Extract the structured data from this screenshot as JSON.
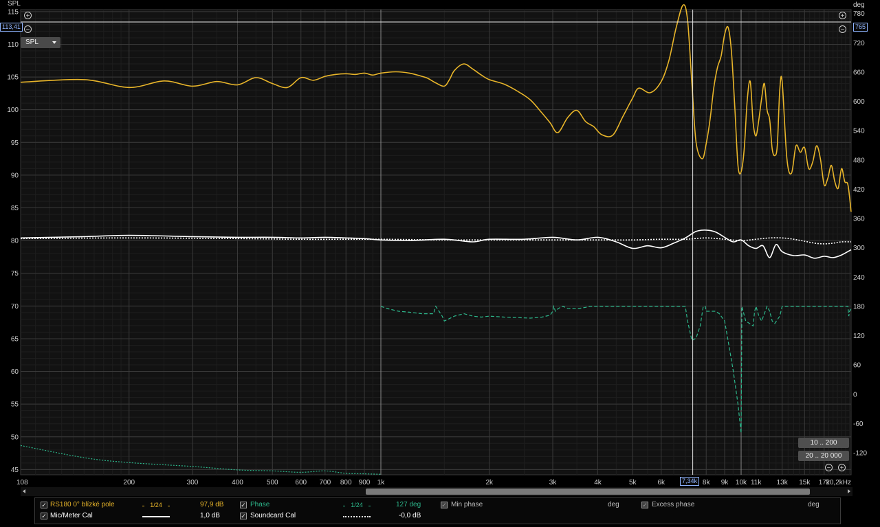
{
  "axes": {
    "left_unit": "SPL",
    "right_unit": "deg",
    "x_unit_suffix": "kHz",
    "left_ticks": [
      "115",
      "110",
      "105",
      "100",
      "95",
      "90",
      "85",
      "80",
      "75",
      "70",
      "65",
      "60",
      "55",
      "50",
      "45"
    ],
    "right_ticks": [
      "780",
      "720",
      "660",
      "600",
      "540",
      "480",
      "420",
      "360",
      "300",
      "240",
      "180",
      "120",
      "60",
      "0",
      "-60",
      "-120"
    ],
    "x_ticks": [
      {
        "f": 100,
        "label": "108"
      },
      {
        "f": 200,
        "label": "200"
      },
      {
        "f": 300,
        "label": "300"
      },
      {
        "f": 400,
        "label": "400"
      },
      {
        "f": 500,
        "label": "500"
      },
      {
        "f": 600,
        "label": "600"
      },
      {
        "f": 700,
        "label": "700"
      },
      {
        "f": 800,
        "label": "800"
      },
      {
        "f": 900,
        "label": "900"
      },
      {
        "f": 1000,
        "label": "1k"
      },
      {
        "f": 2000,
        "label": "2k"
      },
      {
        "f": 3000,
        "label": "3k"
      },
      {
        "f": 4000,
        "label": "4k"
      },
      {
        "f": 5000,
        "label": "5k"
      },
      {
        "f": 6000,
        "label": "6k"
      },
      {
        "f": 8000,
        "label": "8k"
      },
      {
        "f": 9000,
        "label": "9k"
      },
      {
        "f": 10000,
        "label": "10k"
      },
      {
        "f": 11000,
        "label": "11k"
      },
      {
        "f": 13000,
        "label": "13k"
      },
      {
        "f": 15000,
        "label": "15k"
      },
      {
        "f": 17000,
        "label": "17k"
      },
      {
        "f": 20200,
        "label": "20,2kHz"
      }
    ]
  },
  "controls": {
    "spl_select": "SPL",
    "range_low": "10 .. 200",
    "range_high": "20 .. 20 000",
    "zoom_in": "+",
    "zoom_out": "−"
  },
  "cursor": {
    "freq": 7340,
    "freq_label": "7,34k",
    "level": 113.41,
    "level_label": "113,41",
    "deg_label": "765"
  },
  "legend": {
    "row1": [
      {
        "label": "RS180 0° blízké pole",
        "smoothing": "1/24",
        "value": "97,9 dB",
        "color": "#e8b52a"
      },
      {
        "label": "Phase",
        "smoothing": "1/24",
        "value": "127 deg",
        "color": "#2db88c"
      },
      {
        "label": "Min phase",
        "value": "deg",
        "color": "#bdbdbd"
      },
      {
        "label": "Excess phase",
        "value": "deg",
        "color": "#bdbdbd"
      }
    ],
    "row2": [
      {
        "label": "Mic/Meter Cal",
        "value": "1,0 dB",
        "color": "#ffffff"
      },
      {
        "label": "Soundcard Cal",
        "value": "-0,0 dB",
        "color": "#ffffff"
      }
    ]
  },
  "chart_data": {
    "type": "line",
    "x_scale": "log",
    "xlim": [
      100,
      20200
    ],
    "ylim": [
      44.2,
      115.3
    ],
    "y2lim": [
      -165,
      788
    ],
    "grid": true,
    "series": [
      {
        "name": "RS180 0° blízké pole",
        "axis": "left",
        "color": "#e8b52a",
        "x": [
          100,
          150,
          200,
          250,
          300,
          350,
          400,
          450,
          500,
          550,
          600,
          650,
          700,
          750,
          800,
          850,
          900,
          950,
          1000,
          1100,
          1200,
          1300,
          1350,
          1420,
          1500,
          1550,
          1600,
          1700,
          1800,
          1900,
          2000,
          2200,
          2400,
          2600,
          2800,
          2950,
          3100,
          3300,
          3500,
          3700,
          3900,
          4100,
          4400,
          4700,
          5000,
          5200,
          5600,
          6000,
          6300,
          6600,
          6900,
          7100,
          7300,
          7500,
          7800,
          8000,
          8200,
          8400,
          8600,
          8800,
          9000,
          9200,
          9400,
          9600,
          9800,
          10000,
          10200,
          10400,
          10600,
          10800,
          11000,
          11200,
          11400,
          11600,
          11800,
          12000,
          12200,
          12400,
          12600,
          12800,
          13000,
          13400,
          13800,
          14200,
          14600,
          15000,
          15400,
          15800,
          16200,
          16600,
          17000,
          17400,
          17800,
          18200,
          18600,
          19000,
          19400,
          19800,
          20200
        ],
        "y": [
          104.2,
          104.6,
          103.4,
          104.4,
          103.6,
          104.3,
          103.8,
          104.9,
          104.0,
          103.4,
          104.9,
          104.5,
          105.1,
          105.4,
          105.5,
          105.4,
          105.6,
          105.3,
          105.6,
          105.8,
          105.6,
          105.1,
          104.8,
          104.1,
          103.6,
          104.6,
          106.0,
          107.0,
          106.2,
          105.3,
          104.6,
          103.9,
          102.8,
          101.5,
          99.5,
          98.0,
          96.5,
          98.8,
          99.9,
          98.2,
          97.4,
          96.2,
          96.1,
          99.0,
          101.8,
          103.3,
          102.6,
          104.3,
          107.5,
          112.5,
          116.0,
          113.7,
          104.0,
          95.0,
          92.5,
          94.8,
          98.5,
          103.4,
          106.5,
          108.2,
          111.5,
          112.6,
          108.9,
          100.6,
          91.5,
          90.5,
          94.0,
          101.5,
          104.3,
          98.0,
          96.0,
          98.5,
          101.7,
          104.0,
          100.0,
          98.5,
          94.0,
          93.0,
          94.5,
          103.0,
          104.3,
          92.5,
          90.3,
          94.5,
          93.5,
          94.2,
          91.0,
          92.0,
          94.5,
          92.5,
          88.5,
          89.5,
          91.5,
          89.0,
          88.0,
          91.0,
          89.0,
          88.5,
          84.4
        ]
      },
      {
        "name": "Mic/Meter Cal",
        "axis": "left",
        "color": "#ffffff",
        "dash": false,
        "x": [
          100,
          150,
          200,
          300,
          400,
          500,
          600,
          700,
          800,
          900,
          1000,
          1200,
          1500,
          1800,
          2000,
          2500,
          3000,
          3500,
          4000,
          4500,
          5000,
          5500,
          6000,
          6500,
          7000,
          7500,
          8000,
          8500,
          9000,
          9500,
          10000,
          10500,
          11000,
          11500,
          12000,
          12500,
          13000,
          14000,
          15000,
          16000,
          17000,
          18000,
          19000,
          20200
        ],
        "y": [
          80.4,
          80.6,
          80.8,
          80.6,
          80.5,
          80.5,
          80.4,
          80.5,
          80.4,
          80.3,
          80.1,
          80.0,
          80.2,
          79.8,
          80.2,
          80.2,
          80.5,
          80.1,
          80.5,
          79.8,
          78.8,
          79.2,
          78.9,
          79.6,
          80.4,
          81.4,
          81.6,
          81.3,
          80.5,
          79.8,
          80.1,
          79.2,
          78.8,
          79.2,
          77.4,
          79.4,
          78.3,
          77.7,
          77.8,
          77.3,
          77.6,
          77.4,
          77.8,
          78.6
        ]
      },
      {
        "name": "Soundcard Cal",
        "axis": "left",
        "color": "#ffffff",
        "dash": true,
        "x": [
          100,
          200,
          400,
          600,
          800,
          1000,
          1500,
          2000,
          3000,
          4000,
          5000,
          6000,
          7000,
          8000,
          9000,
          10000,
          11000,
          12000,
          13000,
          14000,
          15000,
          16000,
          17000,
          18000,
          19000,
          20200
        ],
        "y": [
          80.3,
          80.4,
          80.3,
          80.2,
          80.2,
          80.2,
          80.1,
          80.1,
          80.1,
          80.1,
          80.1,
          80.2,
          80.2,
          80.4,
          80.2,
          80.0,
          80.2,
          80.4,
          80.4,
          80.2,
          79.9,
          79.6,
          79.5,
          79.6,
          79.8,
          79.8
        ]
      },
      {
        "name": "Phase",
        "axis": "right",
        "color": "#2db88c",
        "x": [
          1000,
          1050,
          1120,
          1200,
          1300,
          1400,
          1420,
          1450,
          1480,
          1500,
          1550,
          1600,
          1700,
          1800,
          1900,
          2000,
          2200,
          2400,
          2600,
          2800,
          2950,
          3000,
          3020,
          3050,
          3100,
          3150,
          3200,
          3300,
          3500,
          3700,
          3800,
          7000,
          7100,
          7300,
          7500,
          7700,
          7850,
          7950,
          8000,
          8500,
          8700,
          9000,
          9200,
          9500,
          9800,
          10000,
          10050,
          10300,
          10800,
          10900,
          11000,
          11200,
          11400,
          11600,
          11800,
          12000,
          12200,
          12400,
          12800,
          13000,
          19800,
          19900,
          20000,
          20200
        ],
        "y": [
          180,
          175,
          170,
          168,
          165,
          165,
          180,
          170,
          160,
          150,
          155,
          160,
          165,
          160,
          158,
          160,
          158,
          157,
          156,
          158,
          162,
          170,
          180,
          170,
          175,
          178,
          180,
          176,
          175,
          178,
          180,
          180,
          150,
          110,
          115,
          140,
          180,
          180,
          170,
          170,
          165,
          150,
          110,
          50,
          -20,
          -80,
          180,
          150,
          140,
          170,
          180,
          160,
          150,
          165,
          180,
          170,
          150,
          145,
          160,
          180,
          180,
          160,
          170,
          175
        ]
      },
      {
        "name": "Excess phase",
        "axis": "right",
        "color": "#2db88c",
        "dash": true,
        "x": [
          100,
          150,
          200,
          300,
          400,
          500,
          600,
          700,
          800,
          900,
          1000
        ],
        "y": [
          -105,
          -130,
          -140,
          -148,
          -155,
          -157,
          -160,
          -157,
          -162,
          -163,
          -164
        ]
      }
    ]
  }
}
